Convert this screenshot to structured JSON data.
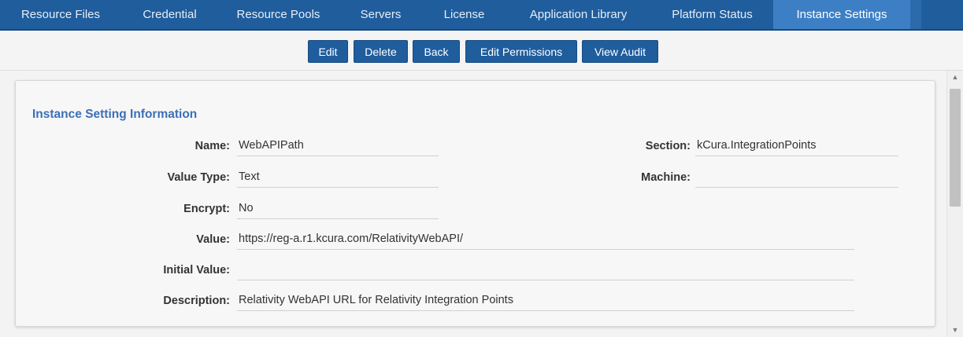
{
  "tabs": [
    {
      "label": "Resource Files"
    },
    {
      "label": "Credential"
    },
    {
      "label": "Resource Pools"
    },
    {
      "label": "Servers"
    },
    {
      "label": "License"
    },
    {
      "label": "Application Library"
    },
    {
      "label": "Platform Status"
    },
    {
      "label": "Instance Settings",
      "active": true
    }
  ],
  "toolbar": {
    "edit": "Edit",
    "delete": "Delete",
    "back": "Back",
    "edit_permissions": "Edit Permissions",
    "view_audit": "View Audit"
  },
  "panel": {
    "title": "Instance Setting Information",
    "fields": {
      "name": {
        "label": "Name:",
        "value": "WebAPIPath"
      },
      "section": {
        "label": "Section:",
        "value": "kCura.IntegrationPoints"
      },
      "value_type": {
        "label": "Value Type:",
        "value": "Text"
      },
      "machine": {
        "label": "Machine:",
        "value": ""
      },
      "encrypt": {
        "label": "Encrypt:",
        "value": "No"
      },
      "value": {
        "label": "Value:",
        "value": "https://reg-a.r1.kcura.com/RelativityWebAPI/"
      },
      "initial_value": {
        "label": "Initial Value:",
        "value": ""
      },
      "description": {
        "label": "Description:",
        "value": "Relativity WebAPI URL for Relativity Integration Points"
      }
    }
  },
  "colors": {
    "tabbar_bg": "#1f5d9d",
    "active_tab_bg": "#3d7fc5",
    "button_bg": "#1f5d9d",
    "title_color": "#3b6fb6"
  },
  "icons": {
    "scroll_up": "▲",
    "scroll_down": "▼"
  }
}
